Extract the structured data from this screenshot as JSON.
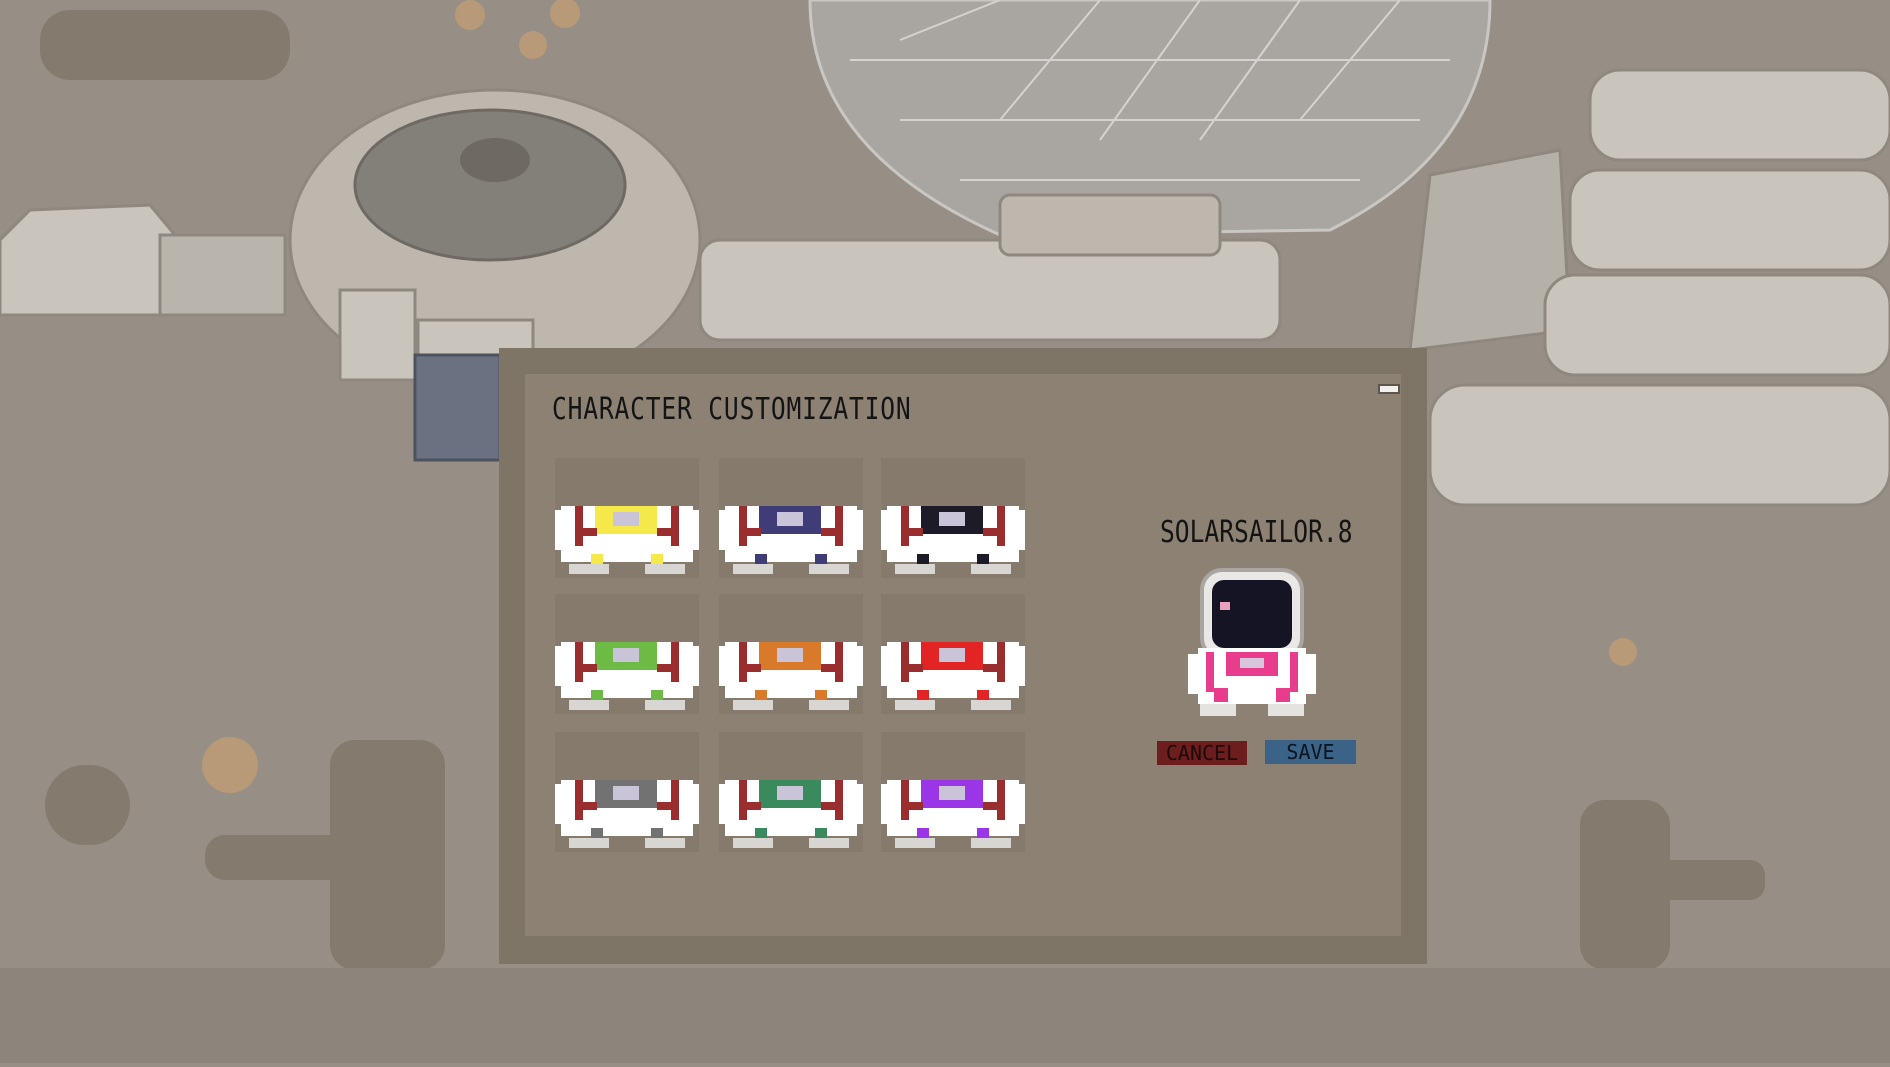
{
  "dialog": {
    "title": "CHARACTER CUSTOMIZATION",
    "minimize_icon": "minimize-icon"
  },
  "suit_colors": [
    {
      "name": "yellow",
      "color": "#f5e84a"
    },
    {
      "name": "navy",
      "color": "#3f3c78"
    },
    {
      "name": "black",
      "color": "#1d1b28"
    },
    {
      "name": "green",
      "color": "#6dbb45"
    },
    {
      "name": "orange",
      "color": "#d97a2a"
    },
    {
      "name": "red",
      "color": "#e22424"
    },
    {
      "name": "gray",
      "color": "#727272"
    },
    {
      "name": "teal",
      "color": "#3a8a5e"
    },
    {
      "name": "purple",
      "color": "#9b35e8"
    }
  ],
  "selected_suit_color": "#e83c8c",
  "preview": {
    "username": "SOLARSAILOR.8",
    "cancel_label": "CANCEL",
    "save_label": "SAVE"
  },
  "colors": {
    "accent_red": "#6c1e1e",
    "accent_blue": "#3b6287",
    "strap": "#9a2e2e",
    "panel": "#7f7567"
  }
}
